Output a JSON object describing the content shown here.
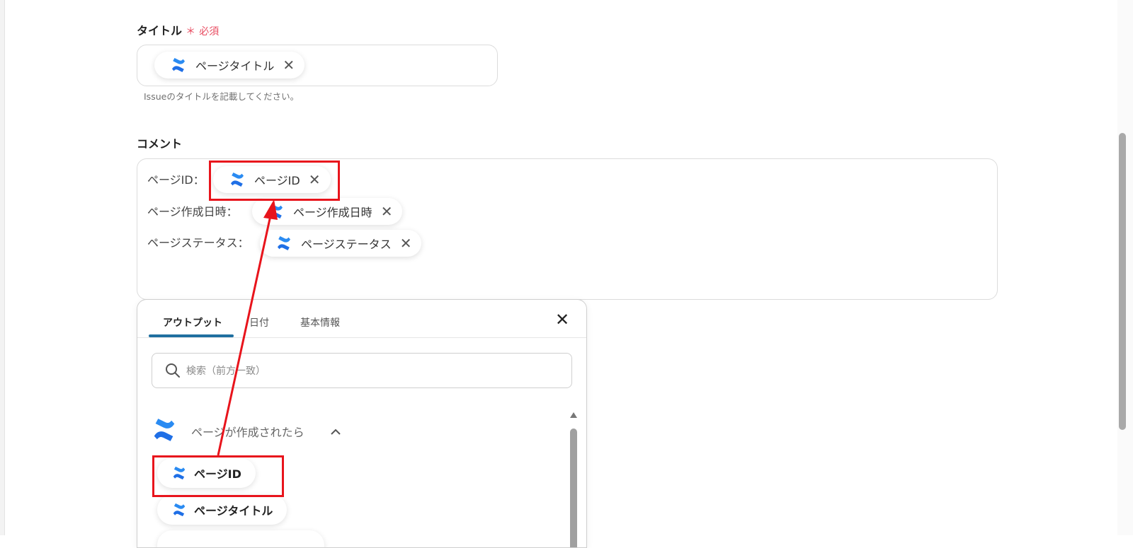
{
  "title_field": {
    "label": "タイトル",
    "required_mark": "＊",
    "required_text": "必須",
    "chip_label": "ページタイトル",
    "hint": "Issueのタイトルを記載してください。"
  },
  "comment_field": {
    "label": "コメント",
    "rows": [
      {
        "label": "ページID：",
        "chip_label": "ページID"
      },
      {
        "label": "ページ作成日時：",
        "chip_label": "ページ作成日時"
      },
      {
        "label": "ページステータス：",
        "chip_label": "ページステータス"
      }
    ]
  },
  "output_panel": {
    "tabs": [
      "アウトプット",
      "日付",
      "基本情報"
    ],
    "active_tab": "アウトプット",
    "close_label": "✕",
    "search_placeholder": "検索（前方一致）",
    "section_title": "ページが作成されたら",
    "items": [
      "ページID",
      "ページタイトル"
    ]
  },
  "colors": {
    "accent_red": "#e8141c",
    "tab_underline": "#1f6fa0",
    "required": "#e84a5f",
    "confluence_blue": "#1f6fe6"
  },
  "icons": {
    "chip": "confluence-logo-icon",
    "chip_close": "close-icon",
    "search": "search-icon",
    "section_toggle": "chevron-up-icon"
  }
}
